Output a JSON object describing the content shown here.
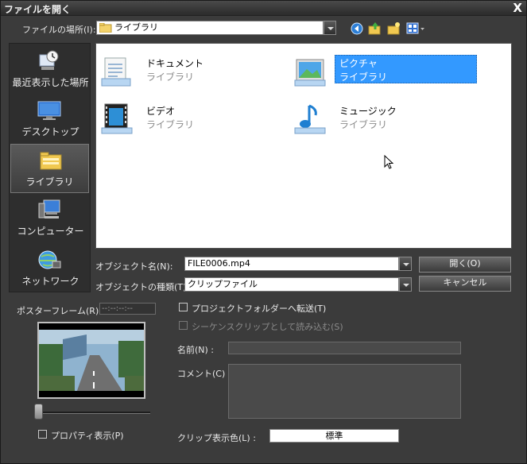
{
  "window": {
    "title": "ファイルを開く",
    "close_glyph": "X"
  },
  "location": {
    "label": "ファイルの場所(I):",
    "value": "ライブラリ"
  },
  "places": [
    {
      "label": "最近表示した場所",
      "icon": "recent-places-icon"
    },
    {
      "label": "デスクトップ",
      "icon": "desktop-icon"
    },
    {
      "label": "ライブラリ",
      "icon": "library-icon",
      "selected": true
    },
    {
      "label": "コンピューター",
      "icon": "computer-icon"
    },
    {
      "label": "ネットワーク",
      "icon": "network-icon"
    }
  ],
  "files": [
    {
      "name": "ドキュメント",
      "type": "ライブラリ",
      "icon": "documents-library-icon"
    },
    {
      "name": "ピクチャ",
      "type": "ライブラリ",
      "icon": "pictures-library-icon",
      "selected": true
    },
    {
      "name": "ビデオ",
      "type": "ライブラリ",
      "icon": "videos-library-icon"
    },
    {
      "name": "ミュージック",
      "type": "ライブラリ",
      "icon": "music-library-icon"
    }
  ],
  "object_name": {
    "label": "オブジェクト名(N):",
    "value": "FILE0006.mp4"
  },
  "object_type": {
    "label": "オブジェクトの種類(T):",
    "value": "クリップファイル"
  },
  "buttons": {
    "open": "開く(O)",
    "cancel": "キャンセル"
  },
  "poster_frame": {
    "label": "ポスターフレーム(R) :",
    "value": "--:--:--:--"
  },
  "options": {
    "transfer_to_project": "プロジェクトフォルダーへ転送(T)",
    "load_as_sequence": "シーケンスクリップとして読み込む(S)",
    "property_display": "プロパティ表示(P)"
  },
  "name_field": {
    "label": "名前(N) :"
  },
  "comment_field": {
    "label": "コメント(C) :"
  },
  "clip_color": {
    "label": "クリップ表示色(L) :",
    "value": "標準"
  },
  "colors": {
    "selection": "#3399ff",
    "background": "#3b3b3b"
  }
}
